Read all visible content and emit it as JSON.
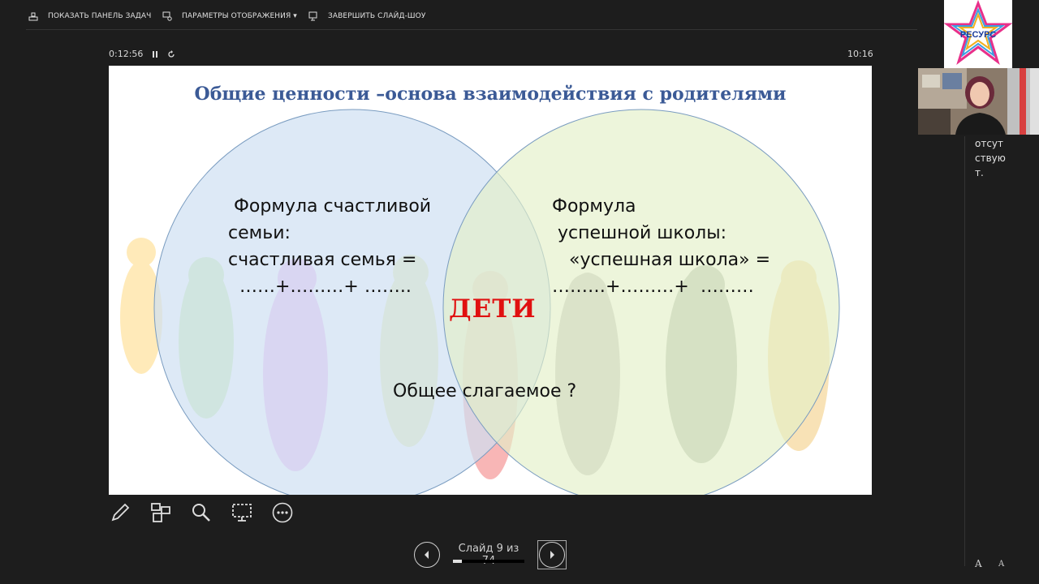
{
  "toolbar": {
    "show_taskbar": "ПОКАЗАТЬ ПАНЕЛЬ ЗАДАЧ",
    "display_settings": "ПАРАМЕТРЫ ОТОБРАЖЕНИЯ ▾",
    "end_slideshow": "ЗАВЕРШИТЬ СЛАЙД-ШОУ"
  },
  "presenter": {
    "elapsed": "0:12:56",
    "clock": "10:16"
  },
  "slide": {
    "title": "Общие ценности –основа взаимодействия с родителями",
    "left_text": " Формула счастливой\nсемьи:\nсчастливая семья =\n  ……+………+ ……..",
    "right_text": "Формула\n успешной школы:\n   «успешная школа» =\n………+………+  ………",
    "center_word": "ДЕТИ",
    "bottom_text": "Общее слагаемое ?",
    "colors": {
      "left_circle": "#cfe0f2",
      "right_circle": "#e3efc8",
      "title": "#3b5a96",
      "accent": "#e01010"
    }
  },
  "navigation": {
    "counter": "Слайд 9 из 74",
    "progress": 0.12
  },
  "tools": [
    "pen-icon",
    "slides-grid-icon",
    "zoom-icon",
    "pointer-screen-icon",
    "more-icon"
  ],
  "logo": {
    "text": "РЕСУРС"
  },
  "side_panel": {
    "text": "отсут\nствую\nт."
  },
  "font_controls": {
    "increase": "A",
    "decrease": "A"
  }
}
